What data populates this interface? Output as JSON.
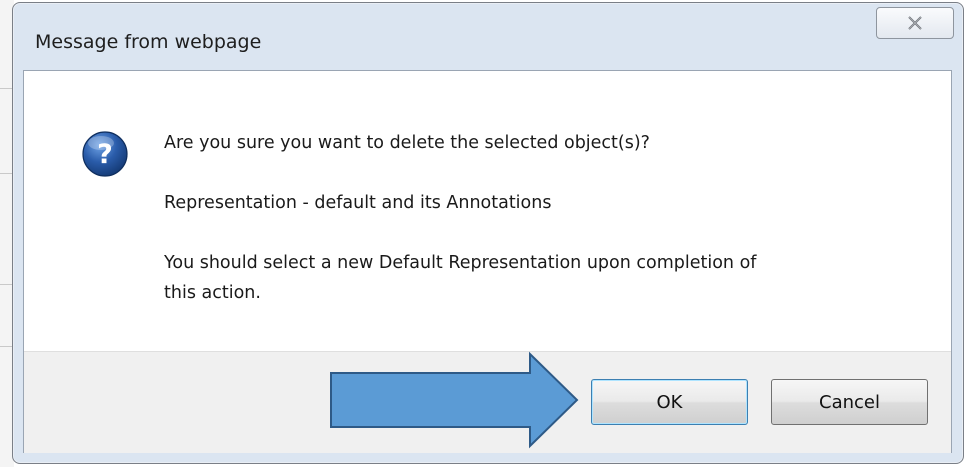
{
  "window": {
    "title": "Message from webpage",
    "close_icon": "close-x-icon"
  },
  "dialog": {
    "icon": "question-icon",
    "icon_glyph": "?",
    "message_line1": "Are you sure you want to delete the selected object(s)?",
    "message_line2": "Representation - default and its Annotations",
    "message_line3a": "You should select a new Default Representation upon completion of",
    "message_line3b": "this action."
  },
  "buttons": {
    "ok_label": "OK",
    "cancel_label": "Cancel"
  },
  "annotation": {
    "arrow_color": "#5b9bd5",
    "arrow_outline": "#2e5a87"
  },
  "colors": {
    "icon_blue": "#2a5caa",
    "button_area": "#f0f0f0",
    "frame": "#dbe5f1"
  }
}
